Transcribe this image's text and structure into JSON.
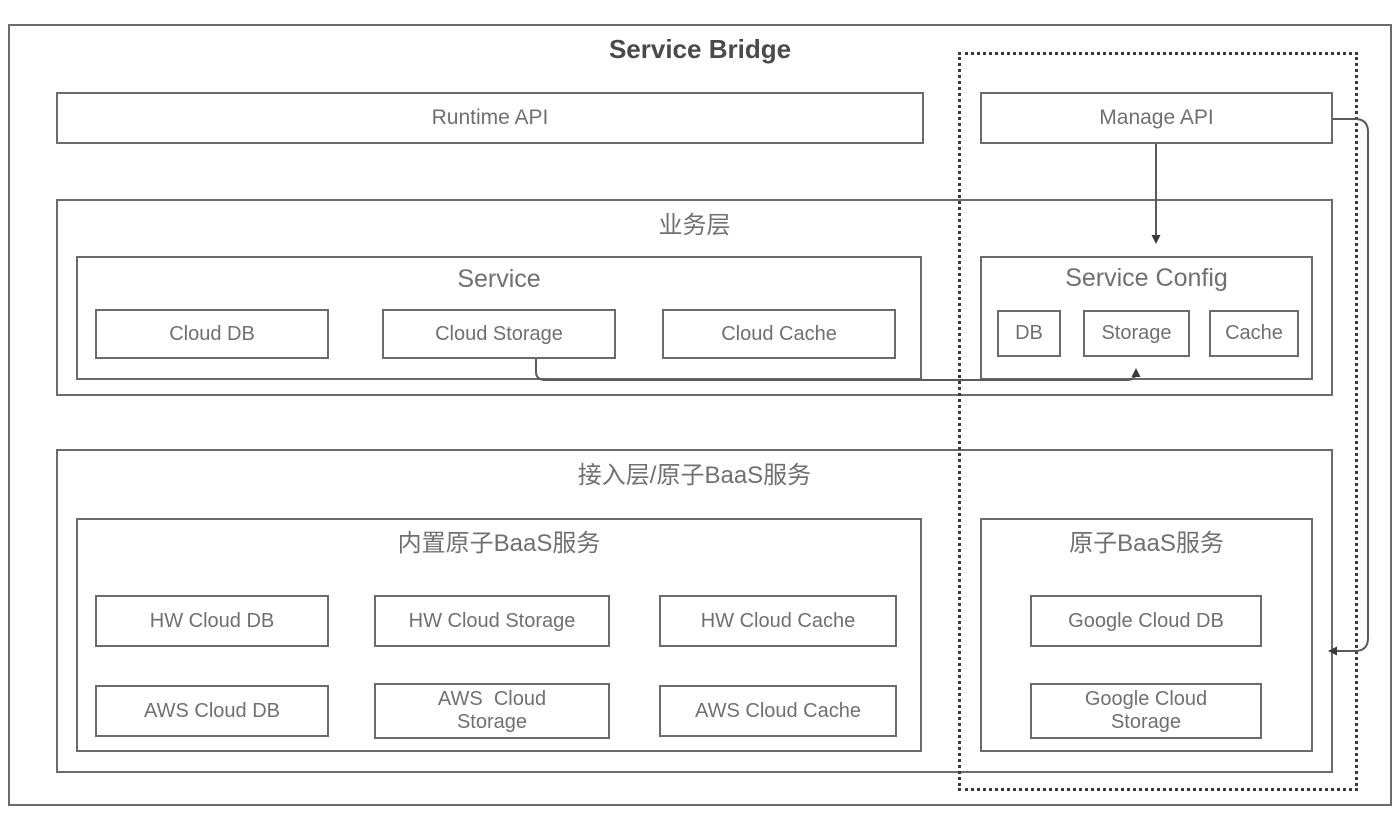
{
  "diagram": {
    "title": "Service Bridge",
    "title_color": "#4a4a4a",
    "box_border_color": "#6b6b6b",
    "text_color": "#707070",
    "dotted_divider_color": "#3a3a3a"
  },
  "api_row": {
    "runtime_api": "Runtime API",
    "manage_api": "Manage API"
  },
  "business_layer": {
    "label": "业务层",
    "service_group": {
      "label": "Service",
      "items": [
        "Cloud DB",
        "Cloud Storage",
        "Cloud Cache"
      ]
    },
    "service_config_group": {
      "label": "Service Config",
      "items": [
        "DB",
        "Storage",
        "Cache"
      ]
    }
  },
  "access_layer": {
    "label": "接入层/原子BaaS服务",
    "builtin_group": {
      "label": "内置原子BaaS服务",
      "rows": [
        [
          "HW Cloud DB",
          "HW Cloud Storage",
          "HW Cloud Cache"
        ],
        [
          "AWS Cloud DB",
          "AWS  Cloud\nStorage",
          "AWS Cloud Cache"
        ]
      ]
    },
    "external_group": {
      "label": "原子BaaS服务",
      "items": [
        "Google Cloud DB",
        "Google Cloud\nStorage"
      ]
    }
  },
  "connectors": [
    {
      "name": "manage-api-to-service-config",
      "from": "Manage API",
      "to": "Service Config"
    },
    {
      "name": "cloud-storage-to-config-storage",
      "from": "Cloud Storage",
      "to": "Storage"
    },
    {
      "name": "manage-api-to-external-baas",
      "from": "Manage API",
      "to": "原子BaaS服务"
    }
  ]
}
